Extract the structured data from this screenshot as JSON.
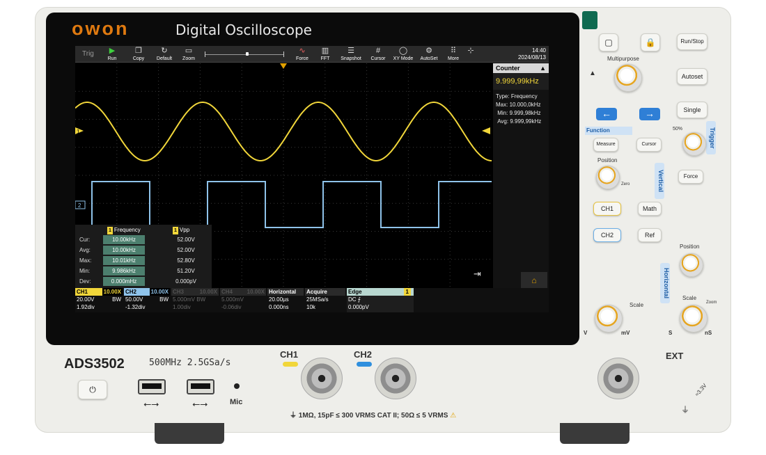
{
  "device": {
    "brand": "owon",
    "product_line": "Digital Oscilloscope",
    "model": "ADS3502",
    "spec": "500MHz 2.5GSa/s",
    "mic_label": "Mic",
    "ch1_label": "CH1",
    "ch2_label": "CH2",
    "ext_label": "EXT",
    "input_rating": "1MΩ, 15pF ≤ 300 VRMS CAT II; 50Ω ≤ 5 VRMS",
    "ext_rating": "≈3.3V",
    "colors": {
      "ch1": "#f1d63a",
      "ch2": "#8fc3ea",
      "accent": "#e07a10"
    }
  },
  "toolbar": {
    "trig": "Trig",
    "run": "Run",
    "copy": "Copy",
    "default": "Default",
    "zoom": "Zoom",
    "force": "Force",
    "fft": "FFT",
    "snapshot": "Snapshot",
    "cursor": "Cursor",
    "xy_mode": "XY Mode",
    "autoset": "AutoSet",
    "more": "More",
    "time": "14:40",
    "date": "2024/08/13"
  },
  "counter": {
    "title": "Counter",
    "value": "9.999,99kHz",
    "type_label": "Type:",
    "type": "Frequency",
    "max_label": "Max:",
    "max": "10.000,0kHz",
    "min_label": "Min:",
    "min": "9.999,98kHz",
    "avg_label": "Avg:",
    "avg": "9.999,99kHz"
  },
  "measurements": {
    "freq_header": "Frequency",
    "vpp_header": "Vpp",
    "rows": [
      {
        "label": "Cur:",
        "freq": "10.00kHz",
        "vpp": "52.00V"
      },
      {
        "label": "Avg:",
        "freq": "10.00kHz",
        "vpp": "52.00V"
      },
      {
        "label": "Max:",
        "freq": "10.01kHz",
        "vpp": "52.80V"
      },
      {
        "label": "Min:",
        "freq": "9.986kHz",
        "vpp": "51.20V"
      },
      {
        "label": "Dev:",
        "freq": "0.000mHz",
        "vpp": "0.000pV"
      }
    ]
  },
  "status": {
    "ch1": {
      "name": "CH1",
      "probe": "10.00X",
      "scale": "20.00V",
      "bw": "BW",
      "offset": "1.92div"
    },
    "ch2": {
      "name": "CH2",
      "probe": "10.00X",
      "scale": "50.00V",
      "bw": "BW",
      "offset": "-1.32div"
    },
    "ch3": {
      "name": "CH3",
      "probe": "10.00X",
      "scale": "5.000mV",
      "bw": "BW",
      "offset": "1.00div"
    },
    "ch4": {
      "name": "CH4",
      "probe": "10.00X",
      "scale": "5.000mV",
      "offset": "-0.06div"
    },
    "horizontal": {
      "title": "Horizontal",
      "timebase": "20.00µs",
      "delay": "0.000ns"
    },
    "acquire": {
      "title": "Acquire",
      "rate": "25MSa/s",
      "depth": "10k"
    },
    "trigger": {
      "title": "Edge",
      "source": "1",
      "coupling": "DC",
      "level": "0.000pV"
    }
  },
  "panel": {
    "run_stop": "Run/Stop",
    "autoset": "Autoset",
    "single": "Single",
    "multipurpose": "Multipurpose",
    "function": "Function",
    "measure": "Measure",
    "cursor": "Cursor",
    "position": "Position",
    "zero": "Zero",
    "vertical": "Vertical",
    "trigger": "Trigger",
    "force": "Force",
    "ch1": "CH1",
    "ch2": "CH2",
    "math": "Math",
    "ref": "Ref",
    "scale": "Scale",
    "v": "V",
    "mv": "mV",
    "horizontal": "Horizontal",
    "h_position": "Position",
    "h_scale": "Scale",
    "zoom": "Zoom",
    "s": "S",
    "ns": "nS",
    "fifty_pct": "50%"
  }
}
